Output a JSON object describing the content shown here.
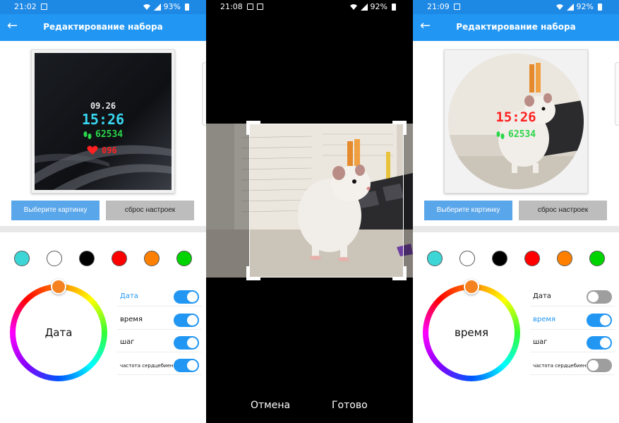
{
  "screens": [
    {
      "status": {
        "time": "21:02",
        "battery": "93%"
      },
      "app_bar": {
        "title": "Редактирование набора"
      },
      "watchface": {
        "date": "09.26",
        "time": "15:26",
        "steps": "62534",
        "heart": "096"
      },
      "buttons": {
        "choose_image": "Выберите картинку",
        "reset": "сброс настроек"
      },
      "color_wheel": {
        "selected_label": "Дата"
      },
      "toggles": [
        {
          "label": "Дата",
          "on": true,
          "active": true
        },
        {
          "label": "время",
          "on": true,
          "active": false
        },
        {
          "label": "шаг",
          "on": true,
          "active": false
        },
        {
          "label": "частота сердцебиения",
          "on": true,
          "active": false
        }
      ]
    },
    {
      "status": {
        "time": "21:08",
        "battery": "92%"
      },
      "crop": {
        "cancel": "Отмена",
        "done": "Готово"
      }
    },
    {
      "status": {
        "time": "21:09",
        "battery": "92%"
      },
      "app_bar": {
        "title": "Редактирование набора"
      },
      "watchface": {
        "time": "15:26",
        "steps": "62534"
      },
      "buttons": {
        "choose_image": "Выберите картинку",
        "reset": "сброс настроек"
      },
      "color_wheel": {
        "selected_label": "время"
      },
      "toggles": [
        {
          "label": "Дата",
          "on": false,
          "active": false
        },
        {
          "label": "время",
          "on": true,
          "active": true
        },
        {
          "label": "шаг",
          "on": true,
          "active": false
        },
        {
          "label": "частота сердцебиения",
          "on": false,
          "active": false
        }
      ]
    }
  ],
  "swatch_colors": [
    "#3dd6d6",
    "#ffffff",
    "#000000",
    "#ff0000",
    "#ff8000",
    "#00d400"
  ],
  "colors": {
    "accent": "#2196f3",
    "button_primary": "#5aa6ea",
    "button_secondary": "#bdbdbd",
    "knob": "#f58220"
  },
  "icons": [
    "back-arrow-icon",
    "wifi-icon",
    "signal-icon",
    "battery-icon",
    "footsteps-icon",
    "heart-icon"
  ]
}
